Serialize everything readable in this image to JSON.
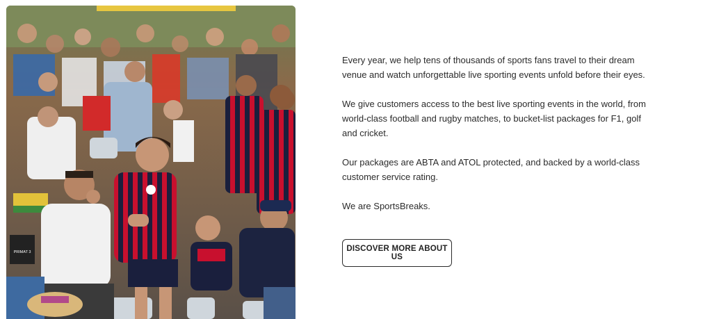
{
  "hero_image": {
    "description_icon": "stadium-fans-photo",
    "sign_text": "PRIMAT 3"
  },
  "about": {
    "paragraphs": [
      "Every year, we help tens of thousands of sports fans travel to their dream venue and watch unforgettable live sporting events unfold before their eyes.",
      "We give customers access to the best live sporting events in the world, from world-class football and rugby matches, to bucket-list packages for F1, golf and cricket.",
      "Our packages are ABTA and ATOL protected, and backed by a world-class customer service rating.",
      "We are SportsBreaks."
    ],
    "cta_label": "DISCOVER MORE ABOUT US"
  },
  "colors": {
    "kit_red": "#c8102e",
    "kit_navy": "#1a1f3d",
    "seat": "#cfd6dc"
  }
}
